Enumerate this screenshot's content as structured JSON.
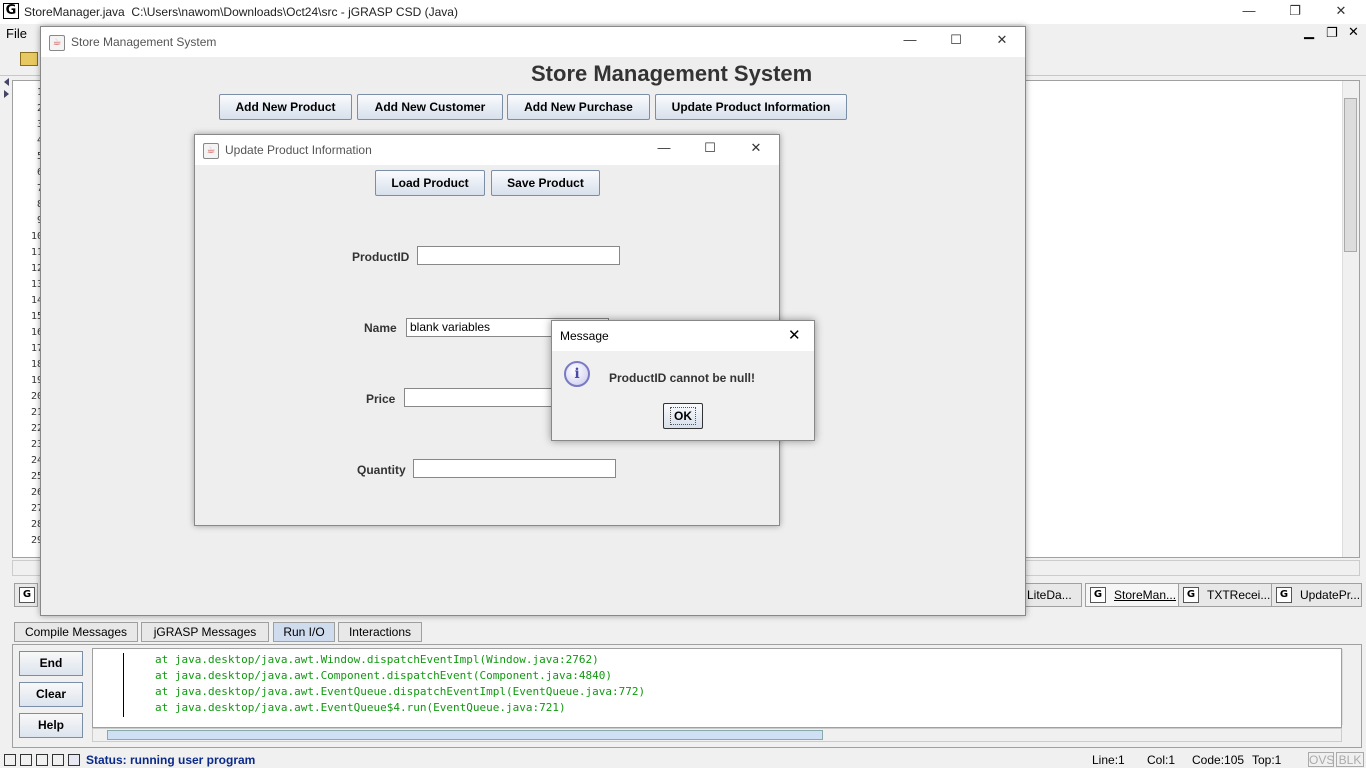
{
  "main_window": {
    "title": "StoreManager.java  C:\\Users\\nawom\\Downloads\\Oct24\\src - jGRASP CSD (Java)",
    "menu_file": "File",
    "line_numbers": [
      "1",
      "2",
      "3",
      "4",
      "5",
      "6",
      "7",
      "8",
      "9",
      "10",
      "11",
      "12",
      "13",
      "14",
      "15",
      "16",
      "17",
      "18",
      "19",
      "20",
      "21",
      "22",
      "23",
      "24",
      "25",
      "26",
      "27",
      "28",
      "29"
    ],
    "file_tabs": [
      "LiteDa...",
      "StoreMan...",
      "TXTRecei...",
      "UpdatePr..."
    ]
  },
  "bottom_pane": {
    "tabs": [
      "Compile Messages",
      "jGRASP Messages",
      "Run I/O",
      "Interactions"
    ],
    "selected_tab": "Run I/O",
    "buttons": {
      "end": "End",
      "clear": "Clear",
      "help": "Help"
    },
    "output_lines": [
      "at java.desktop/java.awt.Window.dispatchEventImpl(Window.java:2762)",
      "at java.desktop/java.awt.Component.dispatchEvent(Component.java:4840)",
      "at java.desktop/java.awt.EventQueue.dispatchEventImpl(EventQueue.java:772)",
      "at java.desktop/java.awt.EventQueue$4.run(EventQueue.java:721)"
    ]
  },
  "status_bar": {
    "status": "Status: running user program",
    "line": "Line:1",
    "col": "Col:1",
    "code": "Code:105",
    "top": "Top:1",
    "ovs": "OVS",
    "blk": "BLK"
  },
  "store_window": {
    "title": "Store Management System",
    "heading": "Store Management System",
    "buttons": {
      "add_product": "Add New Product",
      "add_customer": "Add New Customer",
      "add_purchase": "Add New Purchase",
      "update_product": "Update Product Information"
    }
  },
  "update_dialog": {
    "title": "Update Product Information",
    "load_button": "Load Product",
    "save_button": "Save Product",
    "fields": {
      "product_id_label": "ProductID",
      "product_id_value": "",
      "name_label": "Name",
      "name_value": "blank variables",
      "price_label": "Price",
      "price_value": "",
      "quantity_label": "Quantity",
      "quantity_value": ""
    }
  },
  "message_dialog": {
    "title": "Message",
    "text": "ProductID cannot be null!",
    "ok": "OK",
    "icon": "info-icon"
  }
}
